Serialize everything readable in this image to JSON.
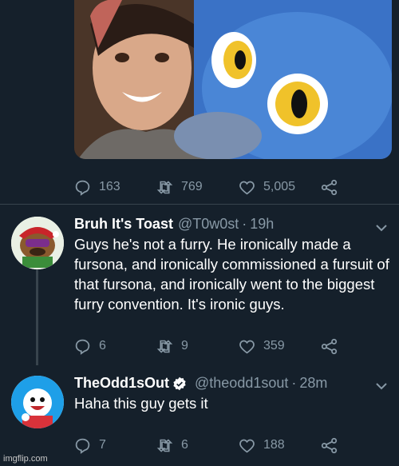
{
  "colors": {
    "background": "#15202b",
    "muted": "#8899a6",
    "divider": "#38444d",
    "verified": "#ffffff"
  },
  "top_tweet": {
    "image": "photo-woman-and-blue-fursuit",
    "replies": "163",
    "retweets": "769",
    "likes": "5,005"
  },
  "reply1": {
    "name": "Bruh It's Toast",
    "handle": "@T0w0st",
    "time": "19h",
    "text": "Guys he's not a furry. He ironically made a fursona, and ironically commissioned a fursuit of that fursona, and ironically went to the biggest furry convention. It's ironic guys.",
    "replies": "6",
    "retweets": "9",
    "likes": "359"
  },
  "reply2": {
    "name": "TheOdd1sOut",
    "handle": "@theodd1sout",
    "time": "28m",
    "text": "Haha this guy gets it",
    "replies": "7",
    "retweets": "6",
    "likes": "188"
  },
  "watermark": "imgflip.com"
}
